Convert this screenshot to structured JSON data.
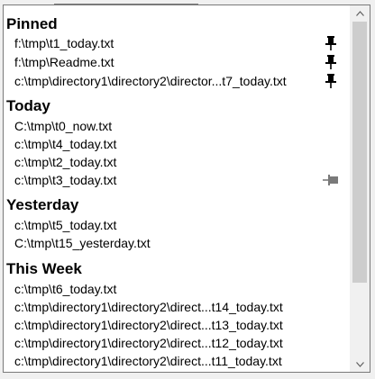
{
  "groups": [
    {
      "header": "Pinned",
      "items": [
        {
          "path": "f:\\tmp\\t1_today.txt",
          "pin_state": "pinned"
        },
        {
          "path": "f:\\tmp\\Readme.txt",
          "pin_state": "pinned"
        },
        {
          "path": "c:\\tmp\\directory1\\directory2\\director...t7_today.txt",
          "pin_state": "pinned"
        }
      ]
    },
    {
      "header": "Today",
      "items": [
        {
          "path": "C:\\tmp\\t0_now.txt"
        },
        {
          "path": "c:\\tmp\\t4_today.txt"
        },
        {
          "path": "c:\\tmp\\t2_today.txt"
        },
        {
          "path": "c:\\tmp\\t3_today.txt",
          "pin_state": "unpinned-hover"
        }
      ]
    },
    {
      "header": "Yesterday",
      "items": [
        {
          "path": "c:\\tmp\\t5_today.txt"
        },
        {
          "path": "C:\\tmp\\t15_yesterday.txt"
        }
      ]
    },
    {
      "header": "This Week",
      "items": [
        {
          "path": "c:\\tmp\\t6_today.txt"
        },
        {
          "path": "c:\\tmp\\directory1\\directory2\\direct...t14_today.txt"
        },
        {
          "path": "c:\\tmp\\directory1\\directory2\\direct...t13_today.txt"
        },
        {
          "path": "c:\\tmp\\directory1\\directory2\\direct...t12_today.txt"
        },
        {
          "path": "c:\\tmp\\directory1\\directory2\\direct...t11_today.txt"
        }
      ]
    }
  ],
  "icons": {
    "pinned": "pushpin-icon",
    "unpinned": "pushpin-sideways-icon",
    "scroll_up": "chevron-up-icon",
    "scroll_down": "chevron-down-icon"
  },
  "colors": {
    "pin_pinned": "#000000",
    "pin_unpinned": "#7a7a7a",
    "scroll_thumb": "#cdcdcd"
  }
}
